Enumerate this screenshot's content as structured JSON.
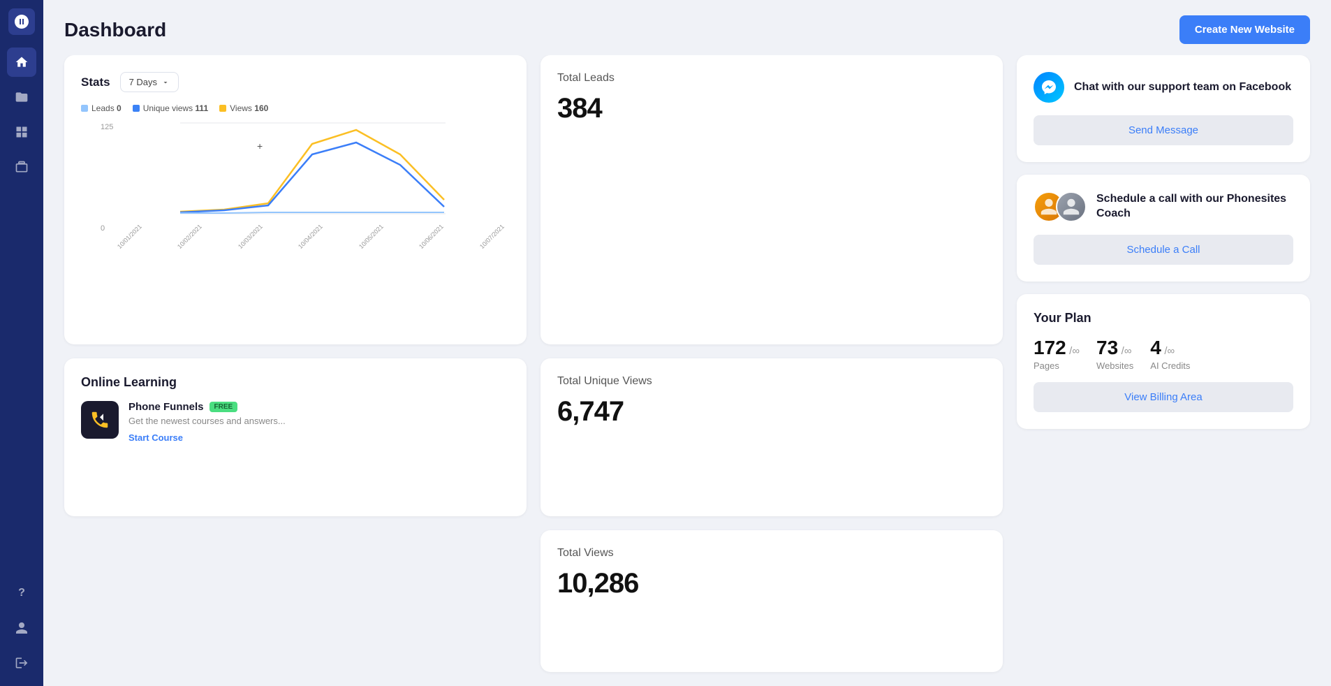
{
  "header": {
    "title": "Dashboard",
    "create_button_label": "Create New Website"
  },
  "sidebar": {
    "logo_alt": "Phonesites logo",
    "items": [
      {
        "id": "home",
        "icon": "home",
        "active": true
      },
      {
        "id": "folder",
        "icon": "folder",
        "active": false
      },
      {
        "id": "grid",
        "icon": "grid",
        "active": false
      },
      {
        "id": "briefcase",
        "icon": "briefcase",
        "active": false
      }
    ],
    "bottom_items": [
      {
        "id": "help",
        "icon": "?"
      },
      {
        "id": "user",
        "icon": "user"
      },
      {
        "id": "logout",
        "icon": "logout"
      }
    ]
  },
  "stats_card": {
    "title": "Stats",
    "dropdown_value": "7 Days",
    "legend": [
      {
        "label": "Leads",
        "value": "0",
        "color": "#93c5fd"
      },
      {
        "label": "Unique views",
        "value": "111",
        "color": "#3b82f6"
      },
      {
        "label": "Views",
        "value": "160",
        "color": "#fbbf24"
      }
    ],
    "y_labels": [
      "125",
      "0"
    ],
    "x_labels": [
      "10/01/2021",
      "10/02/2021",
      "10/03/2021",
      "10/04/2021",
      "10/05/2021",
      "10/06/2021",
      "10/07/2021"
    ],
    "plus_icon": "+"
  },
  "total_leads": {
    "label": "Total Leads",
    "value": "384"
  },
  "total_unique_views": {
    "label": "Total Unique Views",
    "value": "6,747"
  },
  "total_views": {
    "label": "Total Views",
    "value": "10,286"
  },
  "online_learning": {
    "title": "Online Learning",
    "course": {
      "name": "Phone Funnels",
      "badge": "FREE",
      "description": "Get the newest courses and answers...",
      "start_label": "Start Course"
    }
  },
  "support": {
    "text": "Chat with our support team on Facebook",
    "button_label": "Send Message"
  },
  "coach": {
    "text": "Schedule a call with our Phonesites Coach",
    "button_label": "Schedule a Call"
  },
  "plan": {
    "title": "Your Plan",
    "stats": [
      {
        "value": "172",
        "unit": "/∞",
        "label": "Pages"
      },
      {
        "value": "73",
        "unit": "/∞",
        "label": "Websites"
      },
      {
        "value": "4",
        "unit": "/∞",
        "label": "AI Credits"
      }
    ],
    "billing_label": "View Billing Area"
  },
  "chart": {
    "views_data": [
      5,
      8,
      12,
      90,
      110,
      70,
      20
    ],
    "unique_data": [
      3,
      6,
      10,
      70,
      85,
      55,
      15
    ],
    "leads_data": [
      1,
      1,
      2,
      2,
      2,
      2,
      1
    ]
  }
}
